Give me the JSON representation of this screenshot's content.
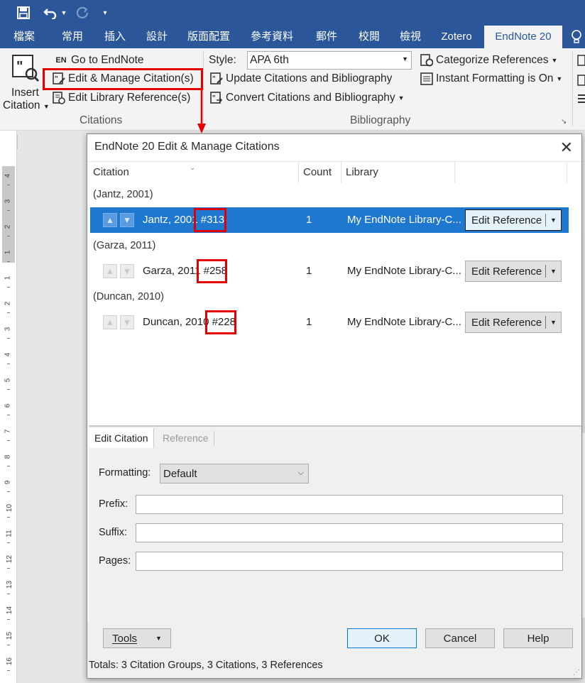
{
  "qat": {
    "save_icon": "save-icon",
    "undo_icon": "undo-icon",
    "redo_icon": "redo-icon",
    "customize_icon": "customize-icon"
  },
  "tabs": [
    "檔案",
    "常用",
    "插入",
    "設計",
    "版面配置",
    "參考資料",
    "郵件",
    "校閱",
    "檢視",
    "Zotero",
    "EndNote 20"
  ],
  "ribbon": {
    "insert_citation": "Insert",
    "insert_citation_2": "Citation",
    "go_to_endnote": "Go to EndNote",
    "en_badge": "EN",
    "edit_manage": "Edit & Manage Citation(s)",
    "edit_library": "Edit Library Reference(s)",
    "citations_group": "Citations",
    "style_label": "Style:",
    "style_value": "APA 6th",
    "update_citations": "Update Citations and Bibliography",
    "convert_citations": "Convert Citations and Bibliography",
    "bibliography_group": "Bibliography",
    "categorize": "Categorize References",
    "instant_formatting": "Instant Formatting is On"
  },
  "accent": "#2b579a",
  "highlight_color": "#e30000",
  "selection_color": "#1e78d0",
  "dialog": {
    "title": "EndNote 20 Edit & Manage Citations",
    "columns": {
      "citation": "Citation",
      "count": "Count",
      "library": "Library"
    },
    "groups": [
      {
        "label": "(Jantz, 2001)",
        "citation": "Jantz, 2001",
        "rec": "#313",
        "count": "1",
        "library": "My EndNote Library-C...",
        "button": "Edit Reference"
      },
      {
        "label": "(Garza, 2011)",
        "citation": "Garza, 2011",
        "rec": "#258",
        "count": "1",
        "library": "My EndNote Library-C...",
        "button": "Edit Reference"
      },
      {
        "label": "(Duncan, 2010)",
        "citation": "Duncan, 2010",
        "rec": "#228",
        "count": "1",
        "library": "My EndNote Library-C...",
        "button": "Edit Reference"
      }
    ],
    "lower_tabs": {
      "edit_citation": "Edit Citation",
      "reference": "Reference"
    },
    "formatting_label": "Formatting:",
    "formatting_value": "Default",
    "prefix_label": "Prefix:",
    "suffix_label": "Suffix:",
    "pages_label": "Pages:",
    "buttons": {
      "tools": "Tools",
      "ok": "OK",
      "cancel": "Cancel",
      "help": "Help"
    },
    "totals": "Totals: 3 Citation Groups, 3 Citations, 3 References"
  },
  "ruler_numbers": [
    "4",
    "3",
    "2",
    "1",
    "1",
    "2",
    "3",
    "4",
    "5",
    "6",
    "7",
    "8",
    "9",
    "10",
    "11",
    "12",
    "13",
    "14",
    "15",
    "16"
  ]
}
